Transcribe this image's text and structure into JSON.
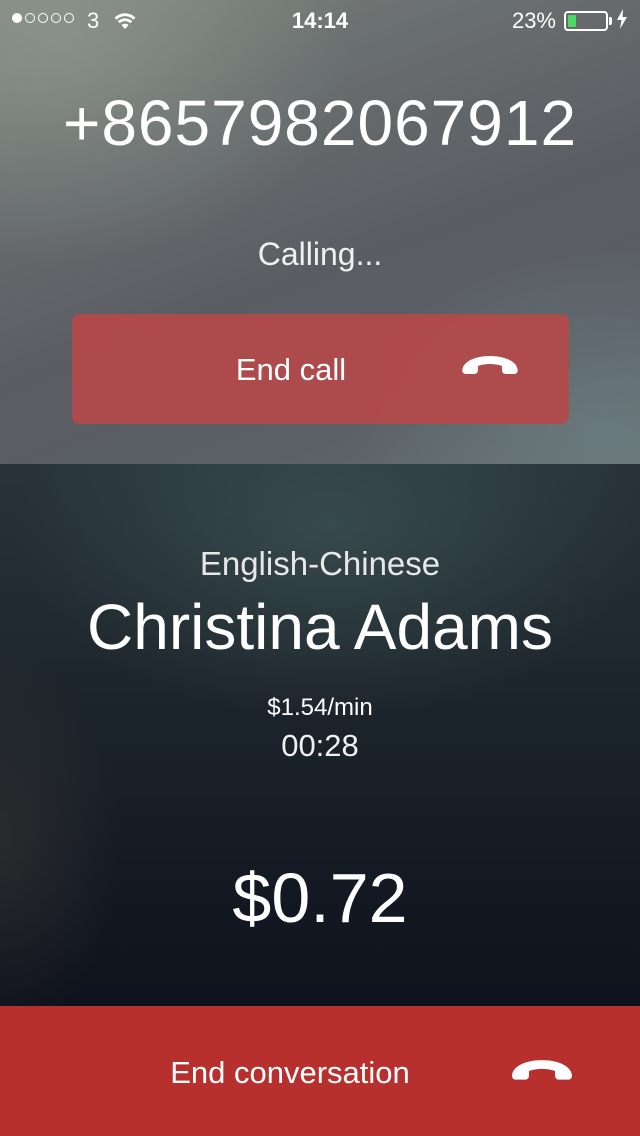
{
  "status_bar": {
    "signal_bars_filled": 1,
    "signal_bars_total": 5,
    "carrier": "3",
    "time": "14:14",
    "battery_percent": "23%",
    "battery_level": 0.23,
    "battery_color": "#4cd964",
    "charging": true
  },
  "call": {
    "phone_number": "+8657982067912",
    "status": "Calling...",
    "end_call_label": "End call"
  },
  "conversation": {
    "language_pair": "English-Chinese",
    "interpreter_name": "Christina Adams",
    "rate": "$1.54/min",
    "duration": "00:28",
    "total_cost": "$0.72",
    "end_conversation_label": "End conversation"
  },
  "colors": {
    "end_call_button": "#bc4646",
    "end_conversation_button": "#b8302e"
  },
  "icons": {
    "wifi": "wifi-icon",
    "battery": "battery-icon",
    "charging": "charging-bolt-icon",
    "hang_up": "phone-hangup-icon"
  }
}
